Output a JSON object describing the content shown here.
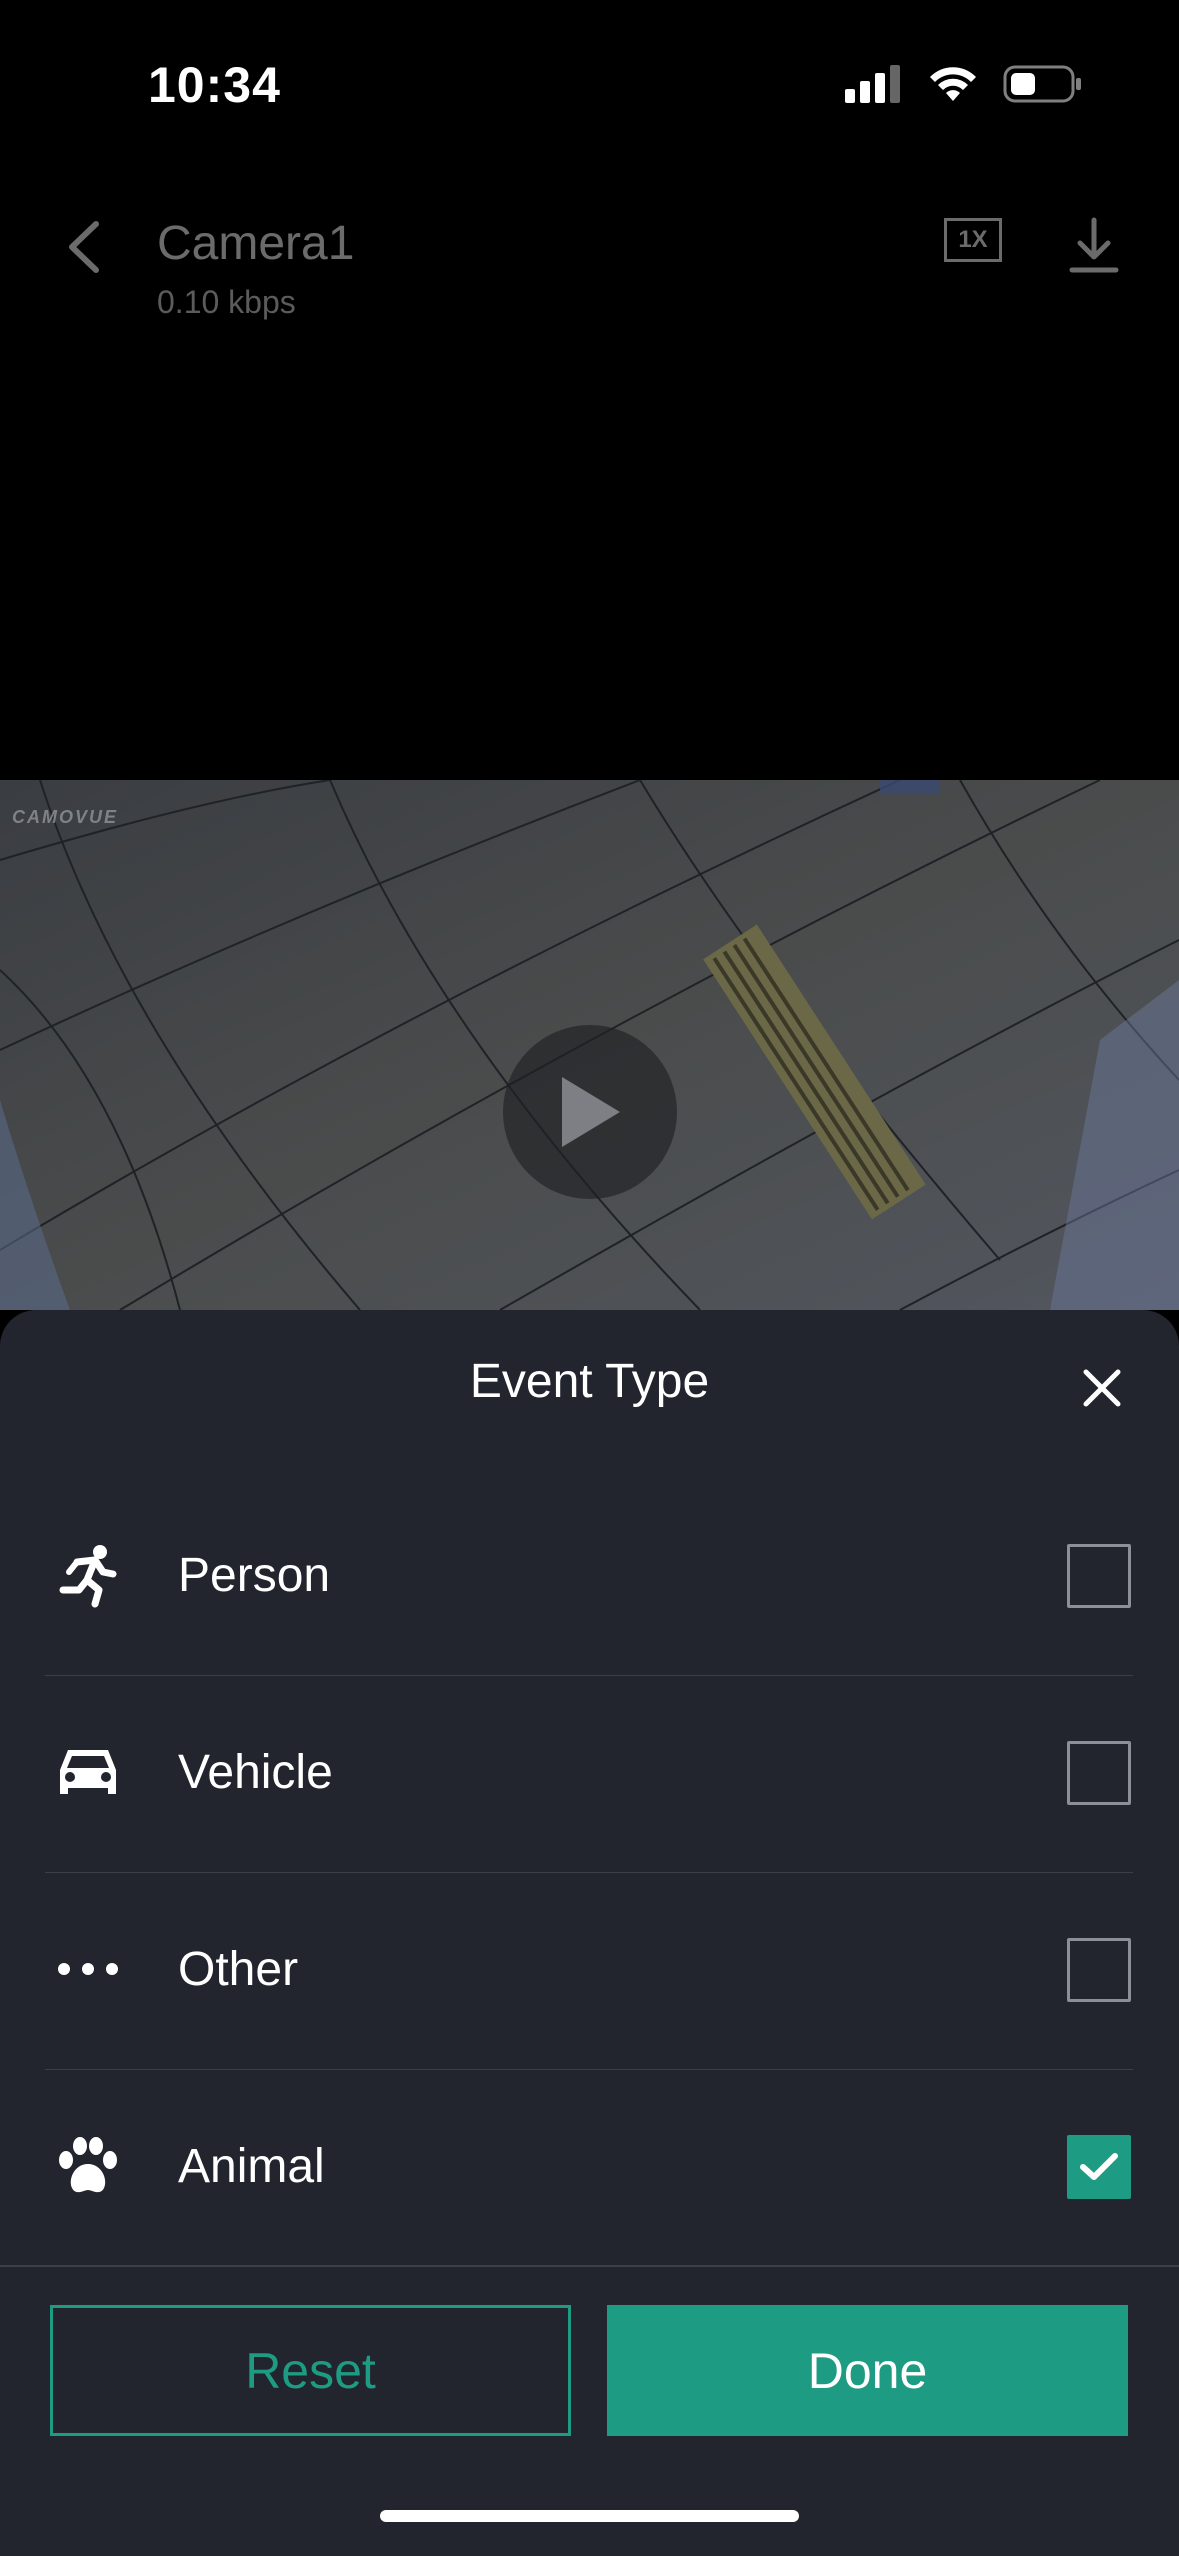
{
  "status_bar": {
    "time": "10:34"
  },
  "header": {
    "title": "Camera1",
    "subtitle": "0.10 kbps",
    "speed_label": "1X"
  },
  "video": {
    "watermark": "CAMOVUE"
  },
  "sheet": {
    "title": "Event Type",
    "options": [
      {
        "label": "Person",
        "icon": "running-person-icon",
        "checked": false
      },
      {
        "label": "Vehicle",
        "icon": "car-icon",
        "checked": false
      },
      {
        "label": "Other",
        "icon": "more-dots-icon",
        "checked": false
      },
      {
        "label": "Animal",
        "icon": "paw-icon",
        "checked": true
      }
    ],
    "reset_label": "Reset",
    "done_label": "Done"
  },
  "colors": {
    "accent": "#1e9b83",
    "sheet_bg": "#22252d"
  }
}
